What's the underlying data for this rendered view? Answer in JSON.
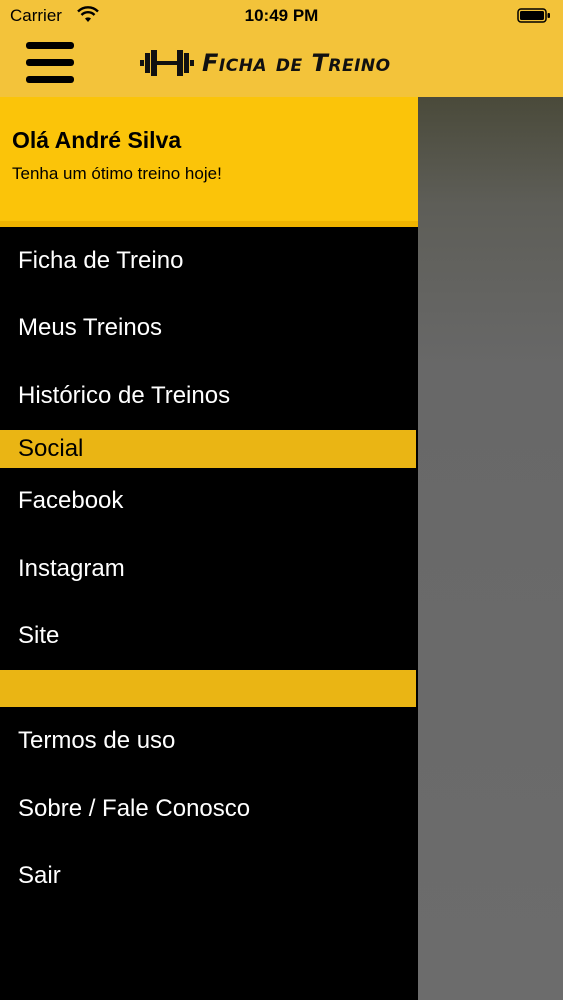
{
  "status_bar": {
    "carrier": "Carrier",
    "time": "10:49 PM"
  },
  "app_bar": {
    "title": "Ficha de Treino",
    "menu_icon": "hamburger-icon",
    "logo_icon": "dumbbell-icon"
  },
  "drawer": {
    "greeting": "Olá André Silva",
    "subtitle": "Tenha um ótimo treino hoje!",
    "items_main": [
      "Ficha de Treino",
      "Meus Treinos",
      "Histórico de Treinos"
    ],
    "section_social": "Social",
    "items_social": [
      "Facebook",
      "Instagram",
      "Site"
    ],
    "section_blank": "",
    "items_footer": [
      "Termos de uso",
      "Sobre / Fale Conosco",
      "Sair"
    ]
  },
  "colors": {
    "accent": "#f3c33a",
    "drawer_bg": "#000000",
    "section_bg": "#eab514"
  }
}
